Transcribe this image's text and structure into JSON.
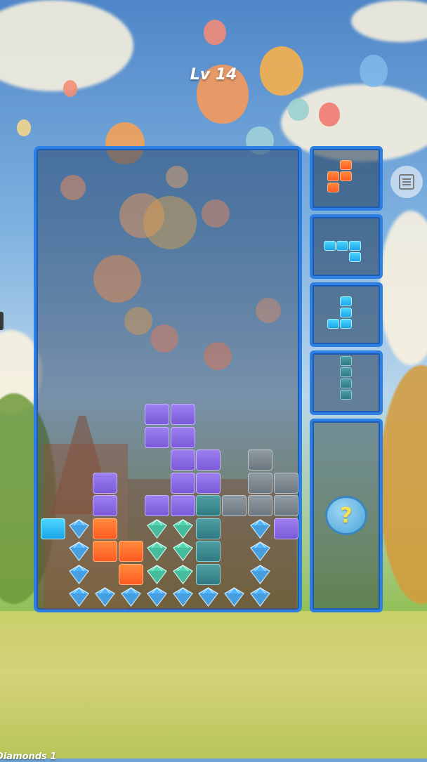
{
  "level_label": "Lv 14",
  "bottom_status": "Diamonds 1",
  "colors": {
    "purple": "#8a6be6",
    "gray": "#7d8790",
    "teal": "#3d8c92",
    "orange": "#ff6a2b",
    "cyan": "#2bbcf2",
    "frame_blue": "#2d7fe3"
  },
  "icons": {
    "help": "question-mark-icon",
    "book": "book-icon",
    "gem": "diamond-icon"
  },
  "help_symbol": "?"
}
